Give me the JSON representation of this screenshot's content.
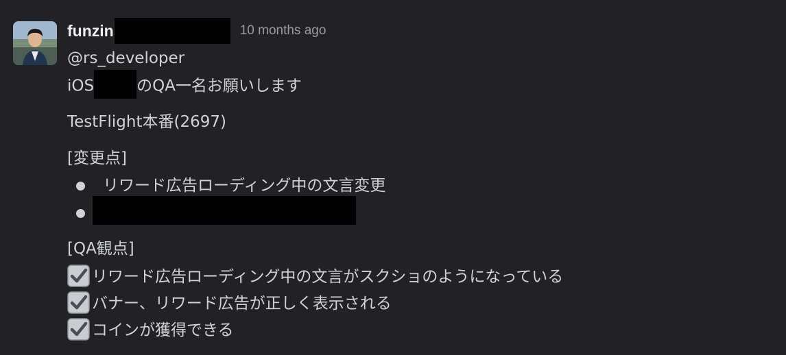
{
  "message": {
    "author": "funzin",
    "timestamp": "10 months ago",
    "mention": "@rs_developer",
    "line_ios_prefix": "iOS",
    "line_ios_suffix": "のQA一名お願いします",
    "testflight": "TestFlight本番(2697)",
    "changes_heading": "[変更点]",
    "changes": [
      "リワード広告ローディング中の文言変更"
    ],
    "qa_heading": "[QA観点]",
    "qa_items": [
      "リワード広告ローディング中の文言がスクショのようになっている",
      "バナー、リワード広告が正しく表示される",
      "コインが獲得できる"
    ],
    "checkbox_icon": "white-heavy-check-mark-icon"
  },
  "colors": {
    "background": "#222226",
    "text": "#d1d2d3",
    "author": "#f0f0f0",
    "timestamp": "#9a9b9d",
    "redaction": "#000000"
  }
}
